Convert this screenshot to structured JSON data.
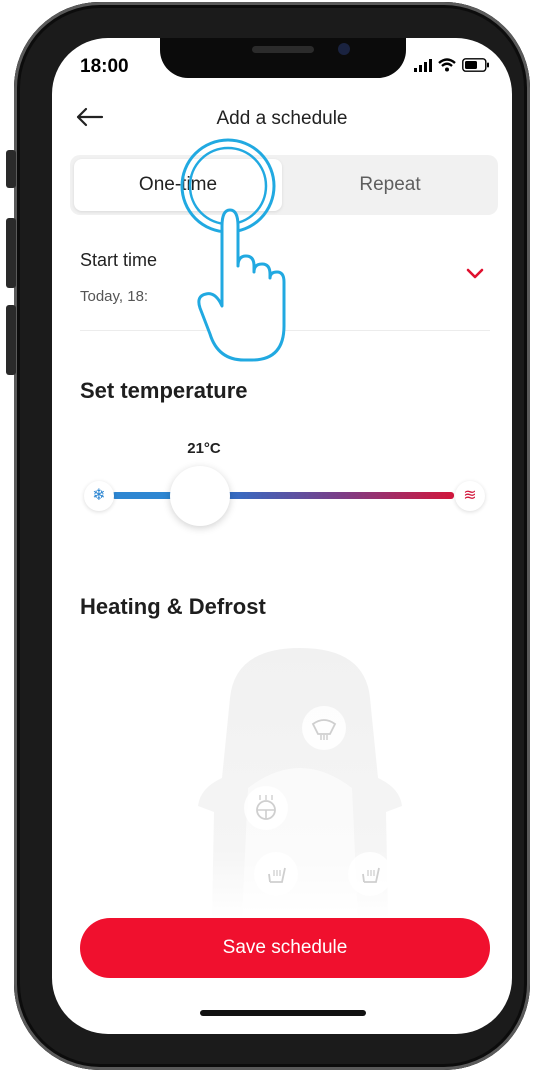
{
  "status_bar": {
    "time": "18:00"
  },
  "header": {
    "title": "Add a schedule"
  },
  "segmented": {
    "options": [
      "One-time",
      "Repeat"
    ],
    "selected": "One-time"
  },
  "start_time": {
    "label": "Start time",
    "value": "Today, 18:"
  },
  "temperature": {
    "title": "Set temperature",
    "value": "21°C",
    "level": 0.2
  },
  "heating": {
    "title": "Heating & Defrost"
  },
  "save_button": {
    "label": "Save schedule"
  },
  "colors": {
    "accent": "#f0102e",
    "cold": "#2d86d2",
    "hot": "#d2163b",
    "touch": "#21a9e1"
  },
  "icons": [
    "back-arrow-icon",
    "chevron-down-icon",
    "snowflake-icon",
    "heat-waves-icon",
    "windshield-defrost-icon",
    "steering-wheel-heat-icon",
    "seat-heat-icon",
    "tap-hand-icon"
  ]
}
